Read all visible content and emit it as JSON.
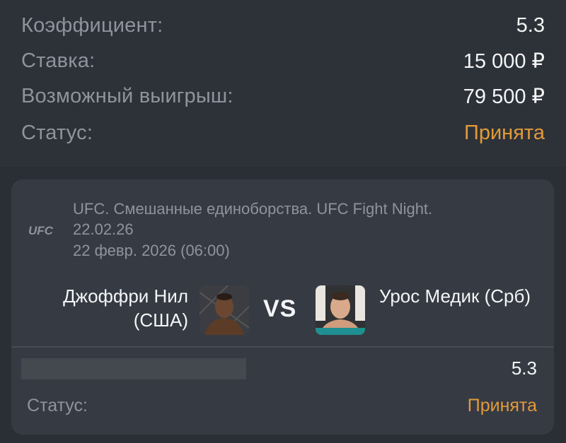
{
  "summary": {
    "odds_label": "Коэффициент:",
    "odds_value": "5.3",
    "stake_label": "Ставка:",
    "stake_value": "15 000 ₽",
    "payout_label": "Возможный выигрыш:",
    "payout_value": "79 500 ₽",
    "status_label": "Статус:",
    "status_value": "Принята"
  },
  "event": {
    "logo_text": "UFC",
    "title": "UFC. Смешанные единоборства. UFC Fight Night. 22.02.26",
    "date": "22 февр. 2026 (06:00)",
    "fighter_left": "Джоффри Нил (США)",
    "fighter_right": "Урос Медик (Срб)",
    "vs_label": "VS"
  },
  "bet_line": {
    "odds_value": "5.3",
    "status_label": "Статус:",
    "status_value": "Принята"
  },
  "colors": {
    "background": "#2a2e35",
    "card": "#363a42",
    "accent": "#e29a3b",
    "muted_text": "#8f949c",
    "primary_text": "#f4f5f7"
  }
}
